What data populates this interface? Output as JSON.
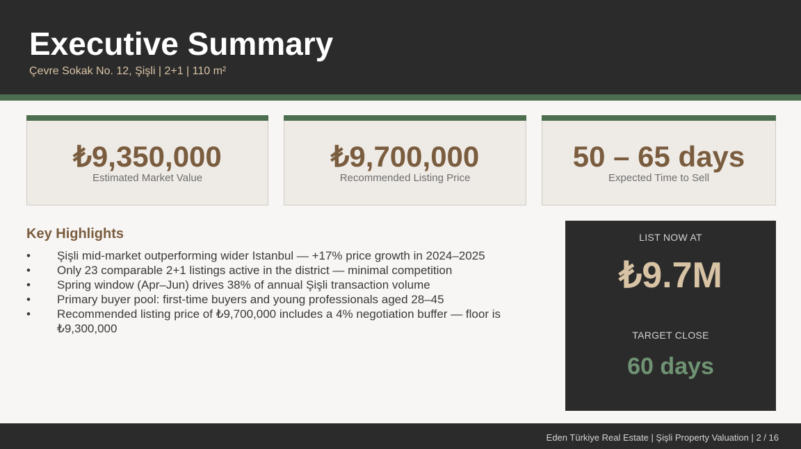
{
  "header": {
    "title": "Executive Summary",
    "subtitle": "Çevre Sokak No. 12, Şişli  |  2+1  |  110 m²"
  },
  "metrics": [
    {
      "value": "₺9,350,000",
      "label": "Estimated Market Value"
    },
    {
      "value": "₺9,700,000",
      "label": "Recommended Listing Price"
    },
    {
      "value": "50 – 65 days",
      "label": "Expected Time to Sell"
    }
  ],
  "highlights": {
    "title": "Key Highlights",
    "bullet_glyph": "•",
    "items": [
      "Şişli mid-market outperforming wider Istanbul — +17% price growth in 2024–2025",
      "Only 23 comparable 2+1 listings active in the district — minimal competition",
      "Spring window (Apr–Jun) drives 38% of annual Şişli transaction volume",
      "Primary buyer pool: first-time buyers and young professionals aged 28–45",
      "Recommended listing price of ₺9,700,000 includes a 4% negotiation buffer — floor is ₺9,300,000"
    ]
  },
  "cta": {
    "list_label": "LIST NOW AT",
    "list_price": "₺9.7M",
    "close_label": "TARGET CLOSE",
    "close_value": "60 days"
  },
  "footer": {
    "text": "Eden Türkiye Real Estate  |  Şişli Property Valuation  |  2 / 16"
  },
  "colors": {
    "dark": "#2b2b2b",
    "accent_green": "#4c6e4f",
    "accent_brown": "#7a5c3e",
    "sand": "#d8c3a5",
    "light_green": "#6f9373"
  }
}
